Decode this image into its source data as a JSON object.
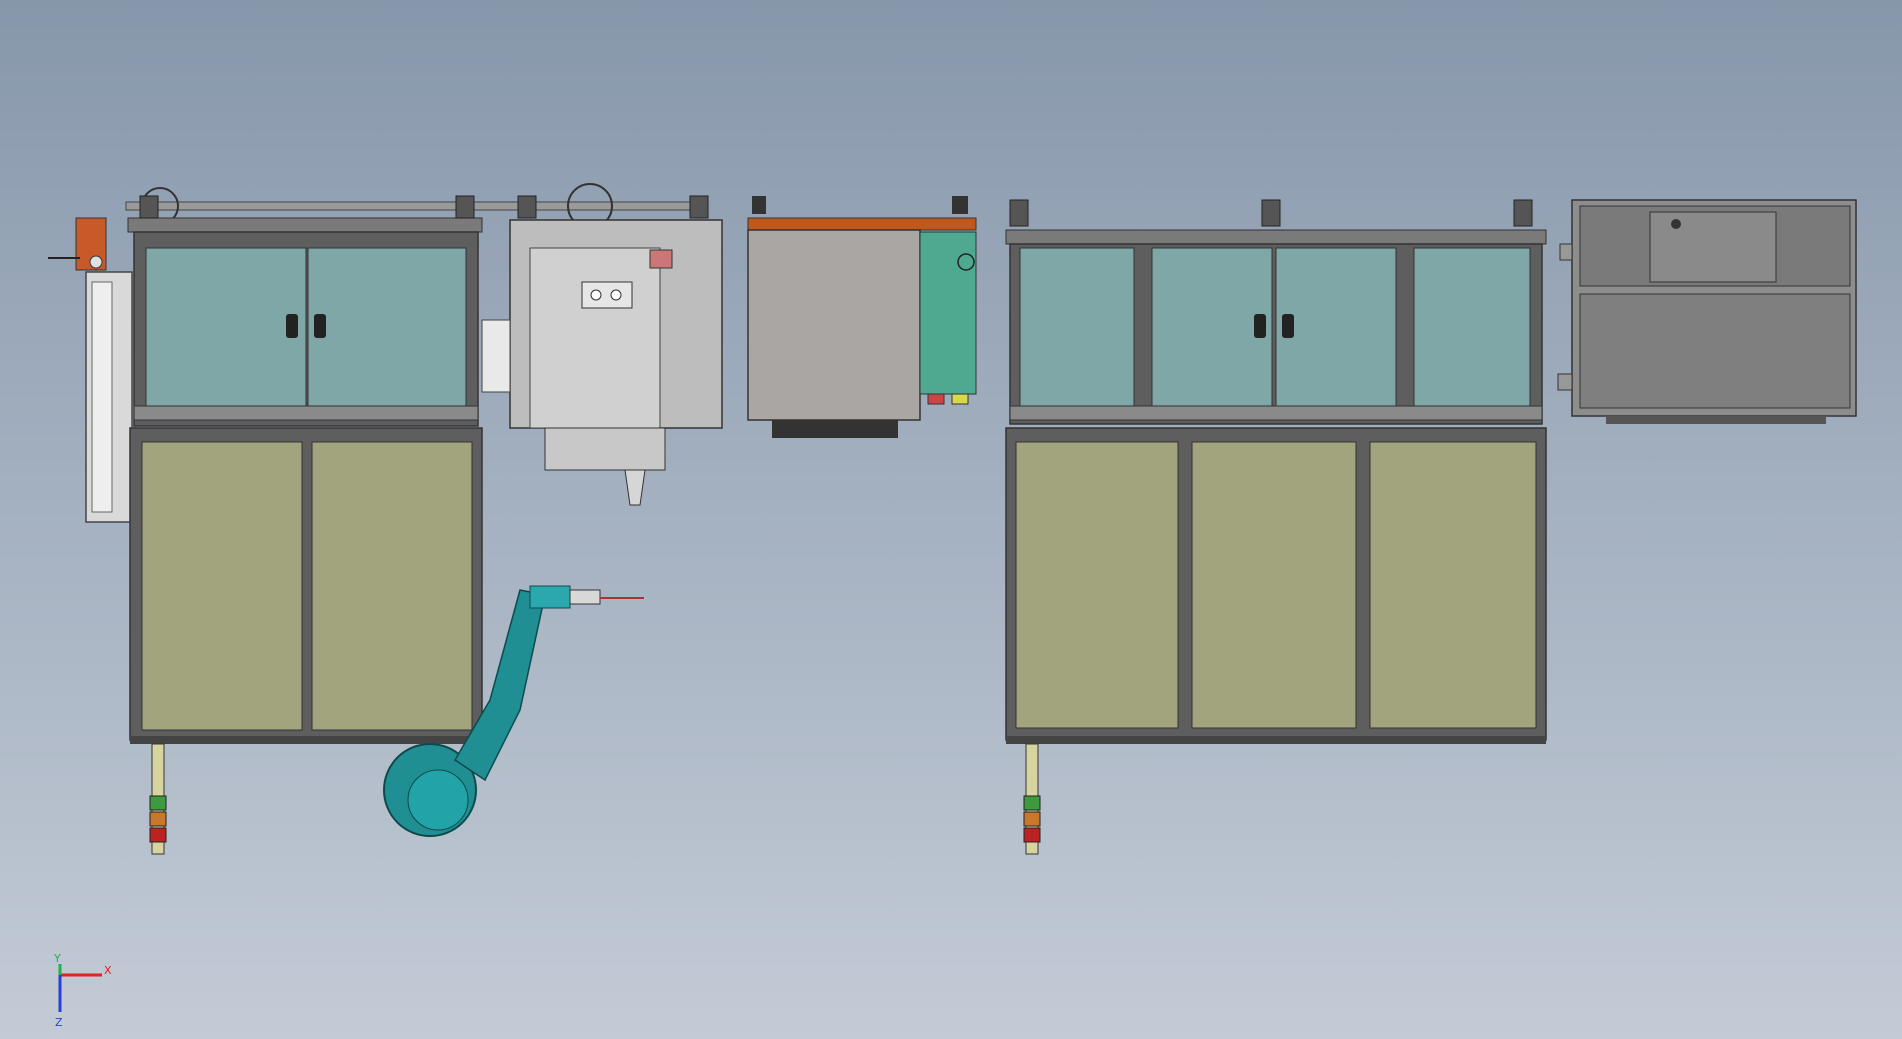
{
  "viewport": {
    "background_top": "#8797ab",
    "background_bottom": "#c3cbd6"
  },
  "triad": {
    "x_label": "X",
    "y_label": "Y",
    "z_label": "Z",
    "x_color": "#e0241b",
    "y_color": "#1fb24a",
    "z_color": "#2a3fd8"
  },
  "colors": {
    "frame": "#6c6c6c",
    "frame_dark": "#3a3a3a",
    "glass": "#7fa7a7",
    "panel_lower": "#a2a47e",
    "robot": "#1f8f94",
    "cabinet_gray": "#aaa6a3",
    "cabinet_top": "#c0581e",
    "cabinet_teal": "#4fa890",
    "box_gray": "#8d8d8d",
    "machine_gray": "#c9c9c9"
  }
}
